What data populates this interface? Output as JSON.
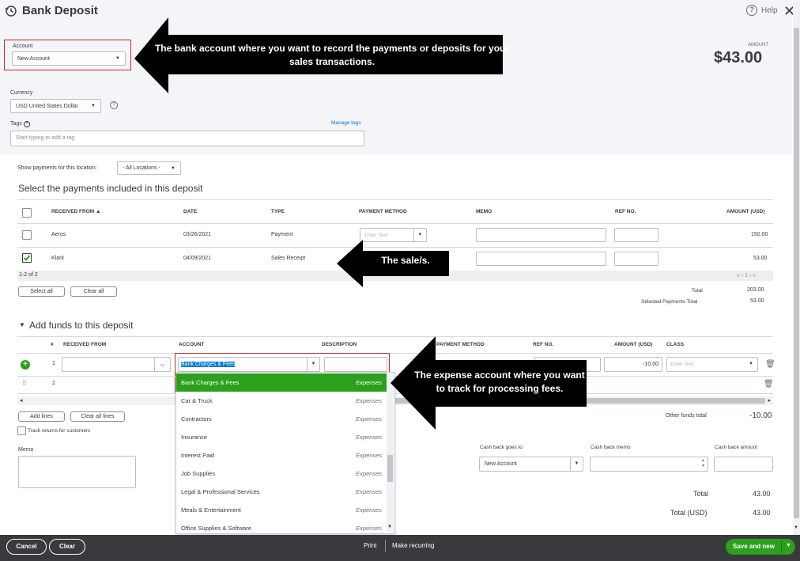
{
  "window": {
    "title": "Bank Deposit",
    "help_label": "Help"
  },
  "account": {
    "label": "Account",
    "value": "New Account"
  },
  "amount": {
    "label": "AMOUNT",
    "value": "$43.00"
  },
  "currency": {
    "label": "Currency",
    "value": "USD United States Dollar"
  },
  "tags": {
    "label": "Tags",
    "manage_label": "Manage tags",
    "placeholder": "Start typing to add a tag"
  },
  "location_filter": {
    "label": "Show payments for this location:",
    "value": "- All Locations -"
  },
  "payments": {
    "title": "Select the payments included in this deposit",
    "columns": [
      "RECEIVED FROM ▲",
      "DATE",
      "TYPE",
      "PAYMENT METHOD",
      "MEMO",
      "REF NO.",
      "AMOUNT (USD)"
    ],
    "rows": [
      {
        "received_from": "Aeros",
        "date": "03/26/2021",
        "type": "Payment",
        "method_placeholder": "Enter Text",
        "amount": "150.00",
        "checked": false
      },
      {
        "received_from": "Klark",
        "date": "04/09/2021",
        "type": "Sales Receipt",
        "method_placeholder": "",
        "amount": "53.00",
        "checked": true
      }
    ],
    "page_info": "1-2 of 2",
    "pager": "« ‹ 1 › »",
    "select_all": "Select all",
    "clear_all": "Clear all",
    "total_label": "Total",
    "total_value": "203.00",
    "selected_label": "Selected Payments Total",
    "selected_value": "53.00"
  },
  "funds": {
    "title": "Add funds to this deposit",
    "columns": [
      "#",
      "RECEIVED FROM",
      "ACCOUNT",
      "DESCRIPTION",
      "PAYMENT METHOD",
      "REF NO.",
      "AMOUNT (USD)",
      "CLASS"
    ],
    "row1": {
      "num": "1",
      "account": "Bank Charges & Fees",
      "amount": "-10.00",
      "class_placeholder": "Enter Text"
    },
    "row2": {
      "num": "2"
    },
    "add_lines": "Add lines",
    "clear_all_lines": "Clear all lines",
    "track_returns": "Track returns for customers",
    "other_total_label": "Other funds total",
    "other_total_value": "-10.00"
  },
  "account_dropdown": [
    {
      "name": "Bank Charges & Fees",
      "type": "Expenses"
    },
    {
      "name": "Car & Truck",
      "type": "Expenses"
    },
    {
      "name": "Contractors",
      "type": "Expenses"
    },
    {
      "name": "Insurance",
      "type": "Expenses"
    },
    {
      "name": "Interest Paid",
      "type": "Expenses"
    },
    {
      "name": "Job Supplies",
      "type": "Expenses"
    },
    {
      "name": "Legal & Professional Services",
      "type": "Expenses"
    },
    {
      "name": "Meals & Entertainment",
      "type": "Expenses"
    },
    {
      "name": "Office Supplies & Software",
      "type": "Expenses"
    }
  ],
  "memo": {
    "label": "Memo"
  },
  "cashback": {
    "goes_to_label": "Cash back goes to",
    "goes_to_value": "New Account",
    "memo_label": "Cash back memo",
    "amount_label": "Cash back amount"
  },
  "totals": {
    "total_label": "Total",
    "total_value": "43.00",
    "total_usd_label": "Total (USD)",
    "total_usd_value": "43.00"
  },
  "footer": {
    "cancel": "Cancel",
    "clear": "Clear",
    "print": "Print",
    "make_recurring": "Make recurring",
    "save_new": "Save and new"
  },
  "callouts": {
    "account": "The bank account where you want to record the payments or deposits for your sales transactions.",
    "sale": "The sale/s.",
    "expense": "The expense account where you want to track  for processing fees."
  },
  "colors": {
    "green": "#2ca01c",
    "link": "#0077c5",
    "footer": "#393a3d"
  }
}
